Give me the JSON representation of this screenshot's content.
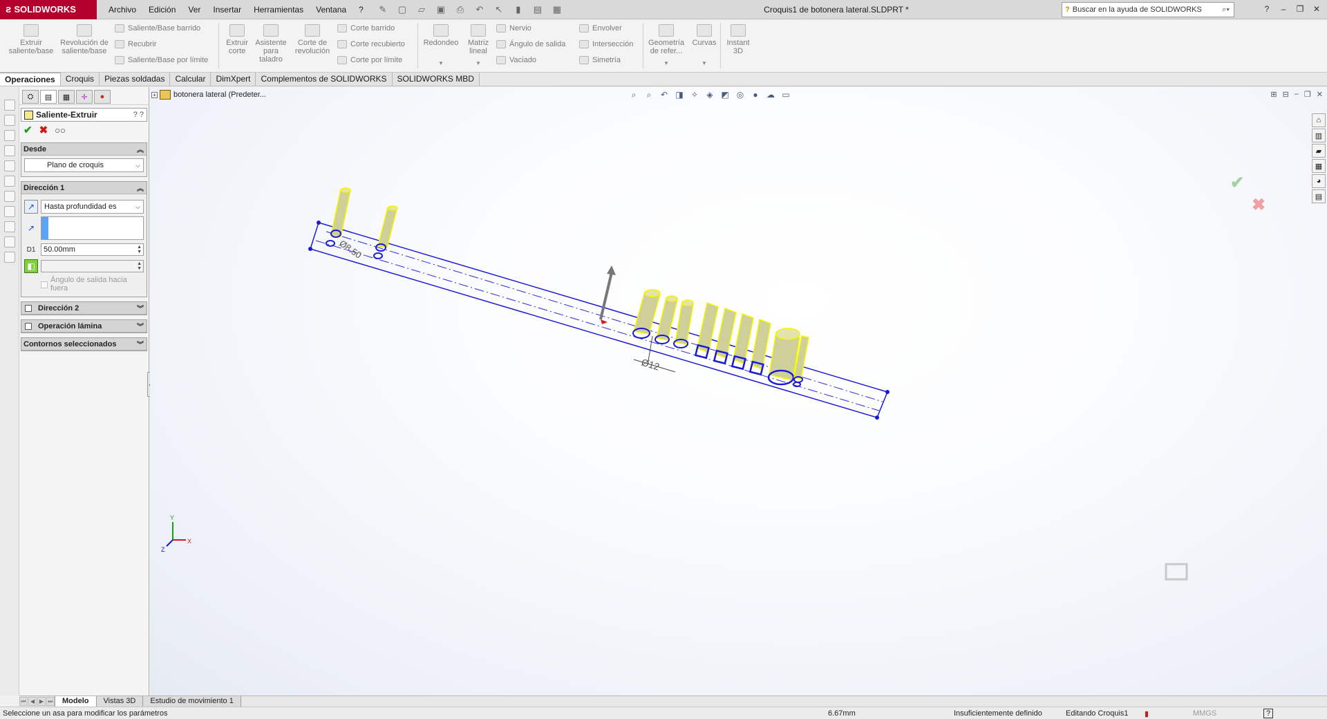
{
  "app": {
    "logo_text": "SOLIDWORKS",
    "title": "Croquis1 de botonera lateral.SLDPRT *",
    "search_placeholder": "Buscar en la ayuda de SOLIDWORKS"
  },
  "menu": [
    "Archivo",
    "Edición",
    "Ver",
    "Insertar",
    "Herramientas",
    "Ventana",
    "?"
  ],
  "commands": {
    "extrude_boss": "Extruir saliente/base",
    "revolve_boss": "Revolución de saliente/base",
    "swept_boss": "Saliente/Base barrido",
    "loft_boss": "Recubrir",
    "boundary_boss": "Saliente/Base por límite",
    "extrude_cut": "Extruir corte",
    "hole_wizard": "Asistente para taladro",
    "revolve_cut": "Corte de revolución",
    "swept_cut": "Corte barrido",
    "loft_cut": "Corte recubierto",
    "boundary_cut": "Corte por límite",
    "fillet": "Redondeo",
    "linear_pattern": "Matriz lineal",
    "rib": "Nervio",
    "draft": "Ángulo de salida",
    "shell": "Vaciado",
    "wrap": "Envolver",
    "intersect": "Intersección",
    "mirror": "Simetría",
    "ref_geometry": "Geometría de refer...",
    "curves": "Curvas",
    "instant3d": "Instant 3D"
  },
  "tabs": [
    "Operaciones",
    "Croquis",
    "Piezas soldadas",
    "Calcular",
    "DimXpert",
    "Complementos de SOLIDWORKS",
    "SOLIDWORKS MBD"
  ],
  "active_tab": "Operaciones",
  "property_manager": {
    "title": "Saliente-Extruir",
    "help": "? ?",
    "from_group": "Desde",
    "from_value": "Plano de croquis",
    "dir1_group": "Dirección 1",
    "end_condition": "Hasta profundidad es",
    "depth": "50.00mm",
    "draft_outward": "Ángulo de salida hacia fuera",
    "dir2_group": "Dirección 2",
    "thin_group": "Operación lámina",
    "contours_group": "Contornos seleccionados"
  },
  "tree": {
    "root_label": "botonera lateral  (Predeter..."
  },
  "graphics": {
    "dim_diameter_small": "Ø8.50",
    "dim_diameter_large": "Ø12",
    "axis_x": "X",
    "axis_y": "Y",
    "axis_z": "Z"
  },
  "bottom_tabs": [
    "Modelo",
    "Vistas 3D",
    "Estudio de movimiento 1"
  ],
  "active_bottom_tab": "Modelo",
  "status": {
    "message": "Seleccione un asa para modificar los parámetros",
    "measure": "6.67mm",
    "definition": "Insuficientemente definido",
    "editing": "Editando Croquis1",
    "units": "MMGS",
    "help": "?"
  },
  "colors": {
    "brand": "#b4002d",
    "sketch_blue": "#1a1ad6",
    "cylinder": "#cfcf9a",
    "highlight": "#f5f500"
  }
}
